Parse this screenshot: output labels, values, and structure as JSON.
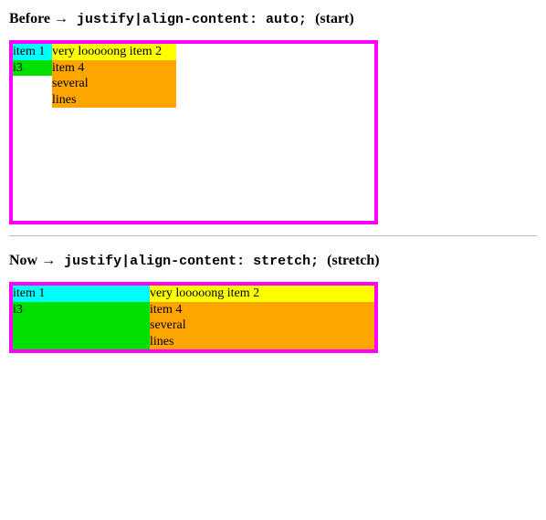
{
  "before": {
    "heading_prefix": "Before ",
    "arrow": "→",
    "heading_code": " justify|align-content: auto; ",
    "heading_suffix": "(start)",
    "cells": {
      "c1": "item 1",
      "c2": "very looooong item 2",
      "c3": "i3",
      "c4": "item 4\nseveral\nlines"
    }
  },
  "now": {
    "heading_prefix": "Now ",
    "arrow": "→",
    "heading_code": " justify|align-content: stretch; ",
    "heading_suffix": "(stretch)",
    "cells": {
      "c1": "item 1",
      "c2": "very looooong item 2",
      "c3": "i3",
      "c4": "item 4\nseveral\nlines"
    }
  },
  "colors": {
    "border": "#ff00ff",
    "cyan": "#00ffff",
    "yellow": "#ffff00",
    "green": "#00e000",
    "orange": "#ffa500"
  }
}
